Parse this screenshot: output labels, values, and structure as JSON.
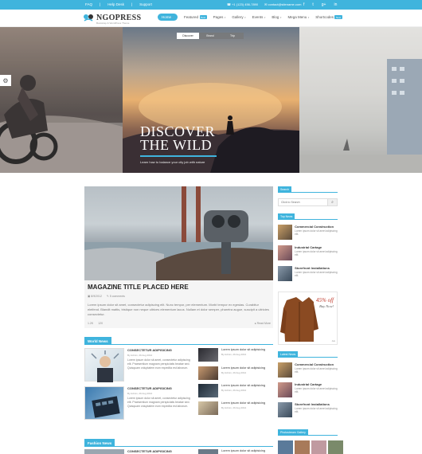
{
  "topbar": {
    "links": [
      "FAQ",
      "Help Desk",
      "Support"
    ],
    "phone": "+1 (123) 456-7890",
    "email": "contact@sitename.com",
    "social": [
      "f",
      "t",
      "g+",
      "in"
    ]
  },
  "brand": {
    "name": "NGOPRESS",
    "tagline": "Bootstrap & WordPress Theme"
  },
  "nav": [
    {
      "label": "Home",
      "badge": "",
      "active": true
    },
    {
      "label": "Featured",
      "badge": "New",
      "active": false
    },
    {
      "label": "Pages",
      "badge": "",
      "active": false
    },
    {
      "label": "Gallery",
      "badge": "",
      "active": false
    },
    {
      "label": "Events",
      "badge": "",
      "active": false
    },
    {
      "label": "Blog",
      "badge": "",
      "active": false
    },
    {
      "label": "Mega Menu",
      "badge": "",
      "active": false
    },
    {
      "label": "Shortcodes",
      "badge": "New",
      "active": false
    }
  ],
  "hero": {
    "tabs": [
      "Discover",
      "Brand",
      "Trip"
    ],
    "title_line1": "DISCOVER",
    "title_line2": "THE WILD",
    "subtitle": "Learn how to balance your city job with nature"
  },
  "feature": {
    "title": "MAGAZINE TITLE PLACED HERE",
    "date": "8/9/2012",
    "comments": "5 comments",
    "text": "Lorem ipsum dolor sit amet, consectetur adipiscing elit. Nunc tempor, per elementum. Morbi tempor ex egestas. Curabitur eleifend. Blandit mattis, tristique non neque ultrices elementum lacus. Nullam et dolor semper, pharetra augue, suscipit a ultricies consectetur.",
    "views": "1.2K",
    "likes": "120",
    "read_more": "Read More"
  },
  "world_news": {
    "label": "World News",
    "items": [
      {
        "title": "CONSECTETUR ADIPISICING",
        "meta": "By Admin, 29 Aug 2012",
        "text": "Lorem ipsum dolor sit amet, consectetur adipiscing elit. Praesentium magnam perspiciatis beatae sed. Quisquam voluptatem eum expedita est laborum."
      },
      {
        "title": "CONSECTETUR ADIPISICING",
        "meta": "By Admin, 29 Aug 2012",
        "text": "Lorem ipsum dolor sit amet, consectetur adipiscing elit. Praesentium magnam perspiciatis beatae sed. Quisquam voluptatem eum expedita est laborum."
      }
    ],
    "mini": [
      {
        "title": "Lorem ipsum dolor sit adipisicing",
        "meta": "By Admin, 29 Aug 2012"
      },
      {
        "title": "Lorem ipsum dolor sit adipisicing",
        "meta": "By Admin, 29 Aug 2012"
      },
      {
        "title": "Lorem ipsum dolor sit adipisicing",
        "meta": "By Admin, 29 Aug 2012"
      },
      {
        "title": "Lorem ipsum dolor sit adipisicing",
        "meta": "By Admin, 29 Aug 2012"
      }
    ]
  },
  "fashion_news": {
    "label": "Fashion News",
    "item_title": "CONSECTETUR ADIPISICING",
    "mini_title": "Lorem ipsum dolor sit adipisicing"
  },
  "sidebar": {
    "search_label": "Search",
    "search_placeholder": "Click to Search",
    "top_news_label": "Top News",
    "top_news": [
      {
        "title": "Commercial Construction",
        "text": "Lorem ipsum dolor sit amet adipiscing elit."
      },
      {
        "title": "Industrial Cartage",
        "text": "Lorem ipsum dolor sit amet adipiscing elit."
      },
      {
        "title": "Storefront Installations",
        "text": "Lorem ipsum dolor sit amet adipiscing elit."
      }
    ],
    "ad": {
      "percent": "45% off",
      "cta": "Buy Now!",
      "tag": "Ads"
    },
    "latest_label": "Latest News",
    "latest": [
      {
        "title": "Commercial Construction",
        "text": "Lorem ipsum dolor sit amet adipiscing elit."
      },
      {
        "title": "Industrial Cartage",
        "text": "Lorem ipsum dolor sit amet adipiscing elit."
      },
      {
        "title": "Storefront Installations",
        "text": "Lorem ipsum dolor sit amet adipiscing elit."
      }
    ],
    "gallery_label": "Photostream Gallery"
  },
  "colors": {
    "accent": "#3fb4dd",
    "text_dark": "#222222"
  }
}
